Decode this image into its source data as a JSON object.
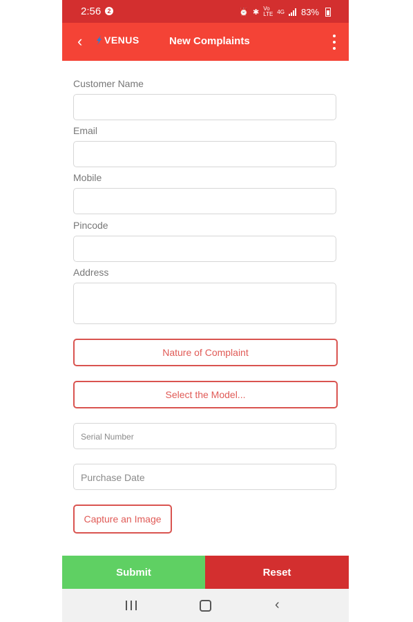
{
  "status_bar": {
    "time": "2:56",
    "notification_badge": "2",
    "battery": "83%",
    "icons": [
      "alarm-icon",
      "bluetooth-icon",
      "volte-icon",
      "4g-icon",
      "signal-icon",
      "battery-icon"
    ]
  },
  "app_bar": {
    "back_icon": "chevron-left-icon",
    "logo_text": "VENUS",
    "title": "New Complaints",
    "menu_icon": "kebab-menu-icon"
  },
  "form": {
    "customer_name_label": "Customer Name",
    "customer_name_value": "",
    "email_label": "Email",
    "email_value": "",
    "mobile_label": "Mobile",
    "mobile_value": "",
    "pincode_label": "Pincode",
    "pincode_value": "",
    "address_label": "Address",
    "address_value": "",
    "nature_of_complaint": "Nature of Complaint",
    "select_model": "Select the Model...",
    "serial_number_placeholder": "Serial Number",
    "purchase_date_placeholder": "Purchase Date",
    "capture_image": "Capture an Image"
  },
  "actions": {
    "submit": "Submit",
    "reset": "Reset"
  },
  "nav_bar": {
    "icons": [
      "recents-icon",
      "home-icon",
      "back-icon"
    ]
  },
  "colors": {
    "status_bar": "#d32f2f",
    "app_bar": "#f44336",
    "accent_outline": "#d9534f",
    "submit": "#5fd063",
    "reset": "#d32f2f"
  }
}
